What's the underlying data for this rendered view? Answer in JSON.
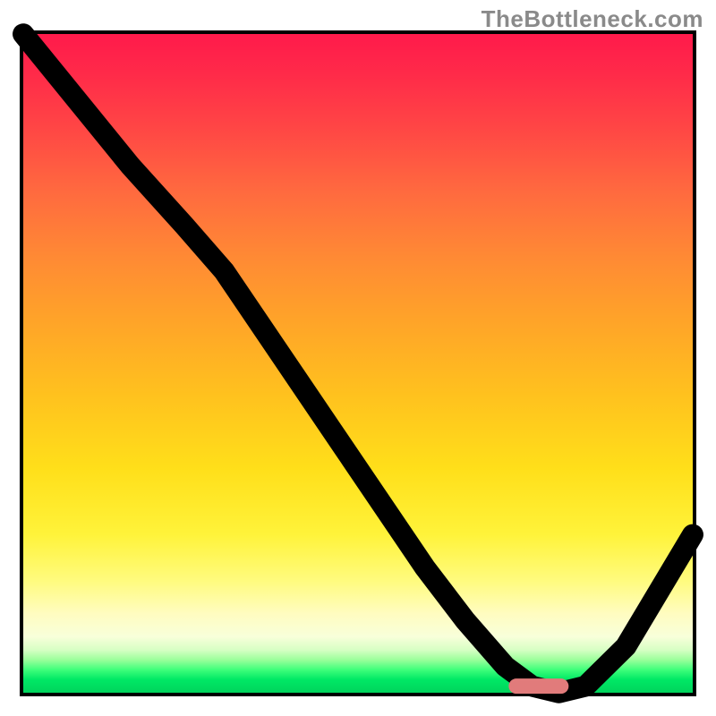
{
  "watermark": "TheBottleneck.com",
  "colors": {
    "border": "#000000",
    "marker": "#e17b7b",
    "gradient_top": "#ff1a4b",
    "gradient_bottom": "#00d45c"
  },
  "chart_data": {
    "type": "line",
    "title": "",
    "xlabel": "",
    "ylabel": "",
    "xlim": [
      0,
      100
    ],
    "ylim": [
      0,
      100
    ],
    "grid": false,
    "x": [
      0,
      8,
      16,
      24,
      30,
      36,
      42,
      48,
      54,
      60,
      66,
      72,
      76,
      80,
      84,
      90,
      100
    ],
    "y": [
      100,
      90,
      80,
      71,
      64,
      55,
      46,
      37,
      28,
      19,
      11,
      4,
      1,
      0,
      1,
      7,
      24
    ],
    "marker": {
      "x": 77,
      "y": 1,
      "width_pct": 9,
      "height_pct": 2.4
    },
    "notes": "y represents the height of the black curve read against the vertical extent of the plot (0 = bottom edge, 100 = top edge). The curve starts pegged to the top-left corner, descends roughly linearly with a slight knee around x≈24, reaches a flat minimum near x≈76–82, then climbs toward the right edge. A small rounded pink marker sits on the flat minimum."
  }
}
